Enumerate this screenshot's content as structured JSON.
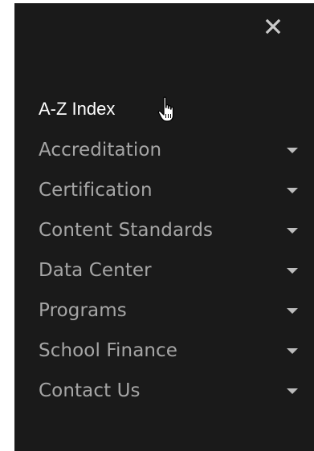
{
  "menu": {
    "close_icon": "close-icon",
    "top_item": {
      "label": "A-Z Index"
    },
    "items": [
      {
        "label": "Accreditation",
        "icon": "caret-down-icon"
      },
      {
        "label": "Certification",
        "icon": "caret-down-icon"
      },
      {
        "label": "Content Standards",
        "icon": "caret-down-icon"
      },
      {
        "label": "Data Center",
        "icon": "caret-down-icon"
      },
      {
        "label": "Programs",
        "icon": "caret-down-icon"
      },
      {
        "label": "School Finance",
        "icon": "caret-down-icon"
      },
      {
        "label": "Contact Us",
        "icon": "caret-down-icon"
      }
    ]
  },
  "colors": {
    "drawer_bg": "#1a1a1a",
    "top_item_text": "#ffffff",
    "item_text": "#a6a6a6",
    "caret": "#bcbcbc",
    "close": "#c9c9c9"
  }
}
